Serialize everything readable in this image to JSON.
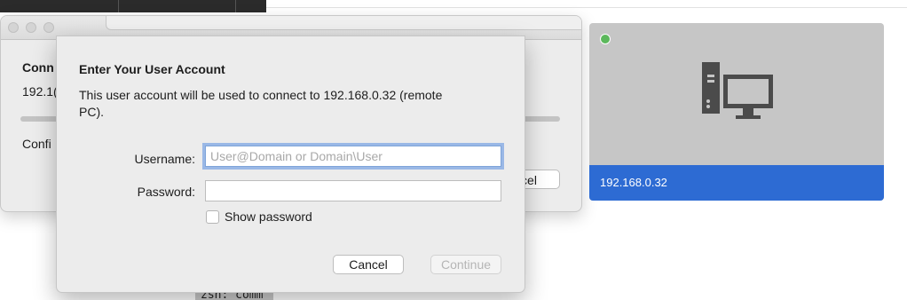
{
  "terminal": {
    "text": "zsh: comm"
  },
  "background_window": {
    "title": "Conn",
    "ip": "192.1(",
    "status": "Confi",
    "cancel_label": "cel"
  },
  "pc_card": {
    "ip": "192.168.0.32",
    "status_color": "#5cb85c",
    "accent": "#2d6bd3",
    "icon": "desktop-computer-icon"
  },
  "dialog": {
    "title": "Enter Your User Account",
    "description": "This user account will be used to connect to 192.168.0.32 (remote PC).",
    "username_label": "Username:",
    "username_placeholder": "User@Domain or Domain\\User",
    "username_value": "",
    "password_label": "Password:",
    "password_value": "",
    "show_password_label": "Show password",
    "show_password_checked": false,
    "cancel_label": "Cancel",
    "continue_label": "Continue"
  }
}
